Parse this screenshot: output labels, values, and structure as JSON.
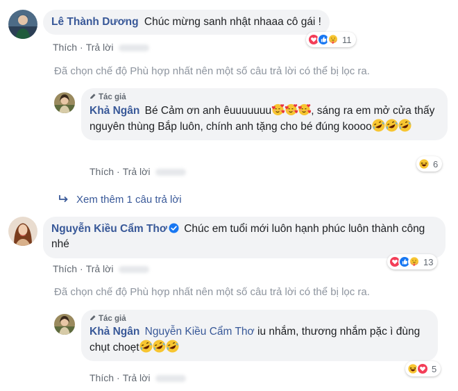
{
  "comments": [
    {
      "author": "Lê Thành Dương",
      "text": "Chúc mừng sanh nhật nhaaa cô gái !",
      "like_label": "Thích",
      "reply_label": "Trả lời",
      "reaction_count": "11",
      "filter_notice": "Đã chọn chế độ Phù hợp nhất nên một số câu trả lời có thể bị lọc ra.",
      "reply": {
        "author_badge": "Tác giả",
        "author": "Khả Ngân",
        "text_part1": "Bé Cảm ơn anh êuuuuuuu",
        "text_part2": ", sáng ra em mở cửa thấy nguyên thùng Bắp luôn, chính anh tặng cho bé đúng koooo",
        "like_label": "Thích",
        "reply_label": "Trả lời",
        "reaction_count": "6"
      },
      "more_replies": "Xem thêm 1 câu trả lời"
    },
    {
      "author": "Nguyễn Kiều Cẩm Thơ",
      "text": "Chúc em tuổi mới luôn hạnh phúc luôn thành công nhé",
      "like_label": "Thích",
      "reply_label": "Trả lời",
      "reaction_count": "13",
      "filter_notice": "Đã chọn chế độ Phù hợp nhất nên một số câu trả lời có thể bị lọc ra.",
      "reply": {
        "author_badge": "Tác giả",
        "author": "Khả Ngân",
        "mention": "Nguyễn Kiều Cẩm Thơ",
        "text": " iu nhắm, thương nhắm pặc ì đùng chụt choẹt",
        "like_label": "Thích",
        "reply_label": "Trả lời",
        "reaction_count": "5"
      }
    }
  ],
  "colors": {
    "link": "#385898",
    "muted": "#606770",
    "bubble": "#f2f3f5",
    "like_blue": "#1877f2",
    "love_red": "#f33e58",
    "haha_yellow": "#f7b125"
  }
}
